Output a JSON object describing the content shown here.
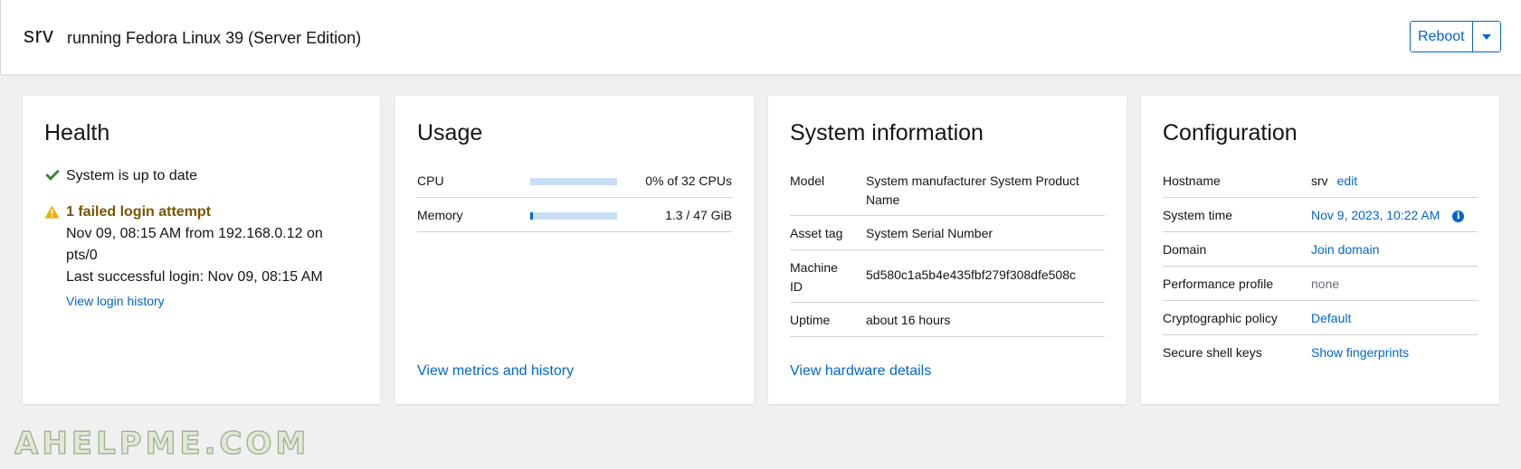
{
  "header": {
    "hostname": "srv",
    "os": "running Fedora Linux 39 (Server Edition)",
    "reboot_label": "Reboot",
    "caret_icon": "caret-down-icon"
  },
  "health": {
    "title": "Health",
    "status": "System is up to date",
    "failed_title": "1 failed login attempt",
    "failed_detail_1": "Nov 09, 08:15 AM from 192.168.0.12 on",
    "failed_detail_2": "pts/0",
    "last_login": "Last successful login: Nov 09, 08:15 AM",
    "login_history_link": "View login history"
  },
  "usage": {
    "title": "Usage",
    "cpu_label": "CPU",
    "cpu_value": "0% of 32 CPUs",
    "cpu_fraction": 0.0,
    "memory_label": "Memory",
    "memory_value": "1.3 / 47 GiB",
    "memory_fraction": 0.028,
    "metrics_link": "View metrics and history"
  },
  "sysinfo": {
    "title": "System information",
    "model_label": "Model",
    "model_value_1": "System manufacturer System Product",
    "model_value_2": "Name",
    "asset_label": "Asset tag",
    "asset_value": "System Serial Number",
    "machine_label_1": "Machine",
    "machine_label_2": "ID",
    "machine_value": "5d580c1a5b4e435fbf279f308dfe508c",
    "uptime_label": "Uptime",
    "uptime_value": "about 16 hours",
    "hardware_link": "View hardware details"
  },
  "config": {
    "title": "Configuration",
    "hostname_label": "Hostname",
    "hostname_value": "srv",
    "hostname_edit": "edit",
    "time_label": "System time",
    "time_value": "Nov 9, 2023, 10:22 AM",
    "info_glyph": "i",
    "domain_label": "Domain",
    "domain_value": "Join domain",
    "perf_label": "Performance profile",
    "perf_value": "none",
    "crypto_label": "Cryptographic policy",
    "crypto_value": "Default",
    "ssh_label": "Secure shell keys",
    "ssh_value": "Show fingerprints"
  },
  "watermark": "AHELPME.COM",
  "colors": {
    "accent": "#0066cc",
    "success": "#3e8635",
    "warning": "#f0ab00",
    "warning_text": "#795600",
    "bar_track": "#c7def3"
  }
}
